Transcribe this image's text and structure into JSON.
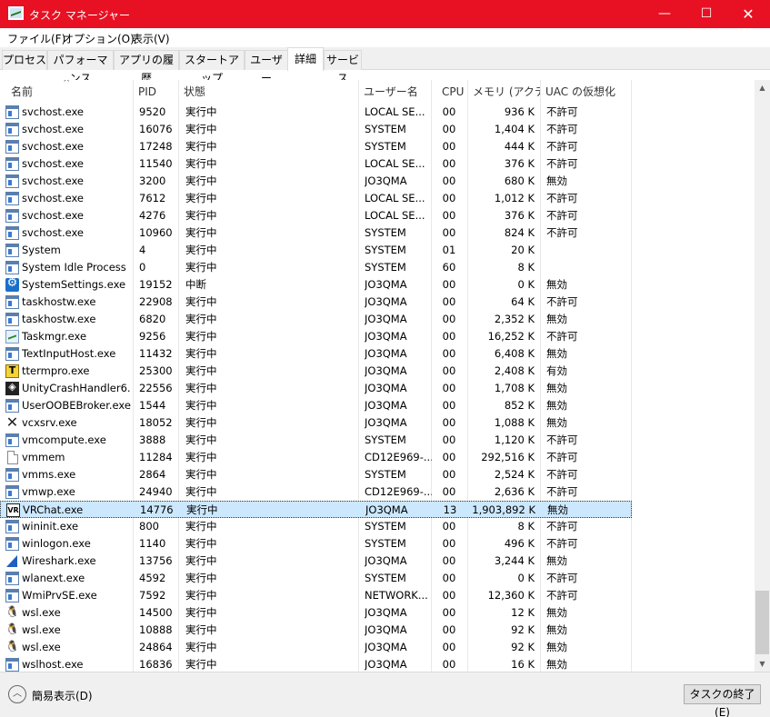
{
  "window": {
    "title": "タスク マネージャー",
    "minimize": "—",
    "maximize": "☐",
    "close": "✕"
  },
  "menu": [
    {
      "label": "ファイル(F)"
    },
    {
      "label": "オプション(O)"
    },
    {
      "label": "表示(V)"
    }
  ],
  "tabs": [
    {
      "label": "プロセス"
    },
    {
      "label": "パフォーマンス"
    },
    {
      "label": "アプリの履歴"
    },
    {
      "label": "スタートアップ"
    },
    {
      "label": "ユーザー"
    },
    {
      "label": "詳細",
      "active": true
    },
    {
      "label": "サービス"
    }
  ],
  "columns": {
    "name": "名前",
    "pid": "PID",
    "status": "状態",
    "user": "ユーザー名",
    "cpu": "CPU",
    "memory": "メモリ (アクテ...",
    "uac": "UAC の仮想化"
  },
  "rows": [
    {
      "icon": "svchost",
      "name": "svchost.exe",
      "pid": "9520",
      "status": "実行中",
      "user": "LOCAL SE...",
      "cpu": "00",
      "mem": "936 K",
      "uac": "不許可"
    },
    {
      "icon": "svchost",
      "name": "svchost.exe",
      "pid": "16076",
      "status": "実行中",
      "user": "SYSTEM",
      "cpu": "00",
      "mem": "1,404 K",
      "uac": "不許可"
    },
    {
      "icon": "svchost",
      "name": "svchost.exe",
      "pid": "17248",
      "status": "実行中",
      "user": "SYSTEM",
      "cpu": "00",
      "mem": "444 K",
      "uac": "不許可"
    },
    {
      "icon": "svchost",
      "name": "svchost.exe",
      "pid": "11540",
      "status": "実行中",
      "user": "LOCAL SE...",
      "cpu": "00",
      "mem": "376 K",
      "uac": "不許可"
    },
    {
      "icon": "svchost",
      "name": "svchost.exe",
      "pid": "3200",
      "status": "実行中",
      "user": "JO3QMA",
      "cpu": "00",
      "mem": "680 K",
      "uac": "無効"
    },
    {
      "icon": "svchost",
      "name": "svchost.exe",
      "pid": "7612",
      "status": "実行中",
      "user": "LOCAL SE...",
      "cpu": "00",
      "mem": "1,012 K",
      "uac": "不許可"
    },
    {
      "icon": "svchost",
      "name": "svchost.exe",
      "pid": "4276",
      "status": "実行中",
      "user": "LOCAL SE...",
      "cpu": "00",
      "mem": "376 K",
      "uac": "不許可"
    },
    {
      "icon": "svchost",
      "name": "svchost.exe",
      "pid": "10960",
      "status": "実行中",
      "user": "SYSTEM",
      "cpu": "00",
      "mem": "824 K",
      "uac": "不許可"
    },
    {
      "icon": "svchost",
      "name": "System",
      "pid": "4",
      "status": "実行中",
      "user": "SYSTEM",
      "cpu": "01",
      "mem": "20 K",
      "uac": ""
    },
    {
      "icon": "svchost",
      "name": "System Idle Process",
      "pid": "0",
      "status": "実行中",
      "user": "SYSTEM",
      "cpu": "60",
      "mem": "8 K",
      "uac": ""
    },
    {
      "icon": "gear",
      "name": "SystemSettings.exe",
      "pid": "19152",
      "status": "中断",
      "user": "JO3QMA",
      "cpu": "00",
      "mem": "0 K",
      "uac": "無効"
    },
    {
      "icon": "svchost",
      "name": "taskhostw.exe",
      "pid": "22908",
      "status": "実行中",
      "user": "JO3QMA",
      "cpu": "00",
      "mem": "64 K",
      "uac": "不許可"
    },
    {
      "icon": "svchost",
      "name": "taskhostw.exe",
      "pid": "6820",
      "status": "実行中",
      "user": "JO3QMA",
      "cpu": "00",
      "mem": "2,352 K",
      "uac": "無効"
    },
    {
      "icon": "taskmgr",
      "name": "Taskmgr.exe",
      "pid": "9256",
      "status": "実行中",
      "user": "JO3QMA",
      "cpu": "00",
      "mem": "16,252 K",
      "uac": "不許可"
    },
    {
      "icon": "svchost",
      "name": "TextInputHost.exe",
      "pid": "11432",
      "status": "実行中",
      "user": "JO3QMA",
      "cpu": "00",
      "mem": "6,408 K",
      "uac": "無効"
    },
    {
      "icon": "teraterm",
      "name": "ttermpro.exe",
      "pid": "25300",
      "status": "実行中",
      "user": "JO3QMA",
      "cpu": "00",
      "mem": "2,408 K",
      "uac": "有効"
    },
    {
      "icon": "unity",
      "name": "UnityCrashHandler6...",
      "pid": "22556",
      "status": "実行中",
      "user": "JO3QMA",
      "cpu": "00",
      "mem": "1,708 K",
      "uac": "無効"
    },
    {
      "icon": "svchost",
      "name": "UserOOBEBroker.exe",
      "pid": "1544",
      "status": "実行中",
      "user": "JO3QMA",
      "cpu": "00",
      "mem": "852 K",
      "uac": "無効"
    },
    {
      "icon": "x",
      "name": "vcxsrv.exe",
      "pid": "18052",
      "status": "実行中",
      "user": "JO3QMA",
      "cpu": "00",
      "mem": "1,088 K",
      "uac": "無効"
    },
    {
      "icon": "svchost",
      "name": "vmcompute.exe",
      "pid": "3888",
      "status": "実行中",
      "user": "SYSTEM",
      "cpu": "00",
      "mem": "1,120 K",
      "uac": "不許可"
    },
    {
      "icon": "file",
      "name": "vmmem",
      "pid": "11284",
      "status": "実行中",
      "user": "CD12E969-...",
      "cpu": "00",
      "mem": "292,516 K",
      "uac": "不許可"
    },
    {
      "icon": "svchost",
      "name": "vmms.exe",
      "pid": "2864",
      "status": "実行中",
      "user": "SYSTEM",
      "cpu": "00",
      "mem": "2,524 K",
      "uac": "不許可"
    },
    {
      "icon": "svchost",
      "name": "vmwp.exe",
      "pid": "24940",
      "status": "実行中",
      "user": "CD12E969-...",
      "cpu": "00",
      "mem": "2,636 K",
      "uac": "不許可"
    },
    {
      "icon": "vr",
      "name": "VRChat.exe",
      "pid": "14776",
      "status": "実行中",
      "user": "JO3QMA",
      "cpu": "13",
      "mem": "1,903,892 K",
      "uac": "無効",
      "selected": true
    },
    {
      "icon": "svchost",
      "name": "wininit.exe",
      "pid": "800",
      "status": "実行中",
      "user": "SYSTEM",
      "cpu": "00",
      "mem": "8 K",
      "uac": "不許可"
    },
    {
      "icon": "svchost",
      "name": "winlogon.exe",
      "pid": "1140",
      "status": "実行中",
      "user": "SYSTEM",
      "cpu": "00",
      "mem": "496 K",
      "uac": "不許可"
    },
    {
      "icon": "shark",
      "name": "Wireshark.exe",
      "pid": "13756",
      "status": "実行中",
      "user": "JO3QMA",
      "cpu": "00",
      "mem": "3,244 K",
      "uac": "無効"
    },
    {
      "icon": "svchost",
      "name": "wlanext.exe",
      "pid": "4592",
      "status": "実行中",
      "user": "SYSTEM",
      "cpu": "00",
      "mem": "0 K",
      "uac": "不許可"
    },
    {
      "icon": "svchost",
      "name": "WmiPrvSE.exe",
      "pid": "7592",
      "status": "実行中",
      "user": "NETWORK...",
      "cpu": "00",
      "mem": "12,360 K",
      "uac": "不許可"
    },
    {
      "icon": "tux",
      "name": "wsl.exe",
      "pid": "14500",
      "status": "実行中",
      "user": "JO3QMA",
      "cpu": "00",
      "mem": "12 K",
      "uac": "無効"
    },
    {
      "icon": "tux",
      "name": "wsl.exe",
      "pid": "10888",
      "status": "実行中",
      "user": "JO3QMA",
      "cpu": "00",
      "mem": "92 K",
      "uac": "無効"
    },
    {
      "icon": "tux",
      "name": "wsl.exe",
      "pid": "24864",
      "status": "実行中",
      "user": "JO3QMA",
      "cpu": "00",
      "mem": "92 K",
      "uac": "無効"
    },
    {
      "icon": "svchost",
      "name": "wslhost.exe",
      "pid": "16836",
      "status": "実行中",
      "user": "JO3QMA",
      "cpu": "00",
      "mem": "16 K",
      "uac": "無効"
    }
  ],
  "footer": {
    "fewer_details": "簡易表示(D)",
    "end_task": "タスクの終了(E)"
  }
}
